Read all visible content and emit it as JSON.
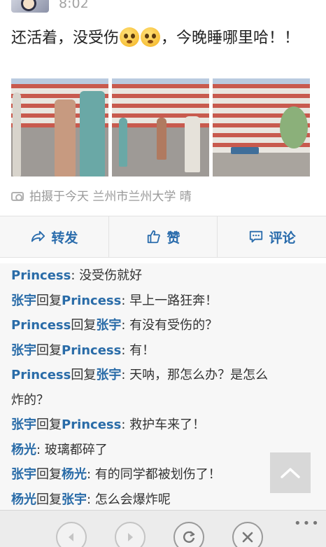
{
  "post": {
    "time": "8:02",
    "text_part1": "还活着，没受伤",
    "text_part2": "，今晚睡哪里哈！！",
    "location": "拍摄于今天 兰州市兰州大学 晴"
  },
  "actions": [
    {
      "label": "转发",
      "icon": "repost-icon"
    },
    {
      "label": "赞",
      "icon": "thumbs-up-icon"
    },
    {
      "label": "评论",
      "icon": "comment-icon"
    }
  ],
  "comments": [
    {
      "author": "Princess",
      "reply_word": "",
      "reply_to": "",
      "text": ": 没受伤就好"
    },
    {
      "author": "张宇",
      "reply_word": "回复",
      "reply_to": "Princess",
      "text": ": 早上一路狂奔！"
    },
    {
      "author": "Princess",
      "reply_word": "回复",
      "reply_to": "张宇",
      "text": ": 有没有受伤的？"
    },
    {
      "author": "张宇",
      "reply_word": "回复",
      "reply_to": "Princess",
      "text": ": 有！"
    },
    {
      "author": "Princess",
      "reply_word": "回复",
      "reply_to": "张宇",
      "text": ": 天呐，那怎么办？是怎么"
    },
    {
      "author": "",
      "reply_word": "",
      "reply_to": "",
      "text": "炸的？"
    },
    {
      "author": "张宇",
      "reply_word": "回复",
      "reply_to": "Princess",
      "text": ": 救护车来了！"
    },
    {
      "author": "杨光",
      "reply_word": "",
      "reply_to": "",
      "text": ": 玻璃都碎了"
    },
    {
      "author": "张宇",
      "reply_word": "回复",
      "reply_to": "杨光",
      "text": ": 有的同学都被划伤了！"
    },
    {
      "author": "杨光",
      "reply_word": "回复",
      "reply_to": "张宇",
      "text": ": 怎么会爆炸呢"
    }
  ],
  "toolbar": {
    "buttons": [
      "back-icon",
      "forward-icon",
      "refresh-icon",
      "close-icon"
    ],
    "more": "•••"
  },
  "colors": {
    "link": "#2a6ca8",
    "action": "#2a6cac",
    "muted": "#9a9a9a"
  }
}
